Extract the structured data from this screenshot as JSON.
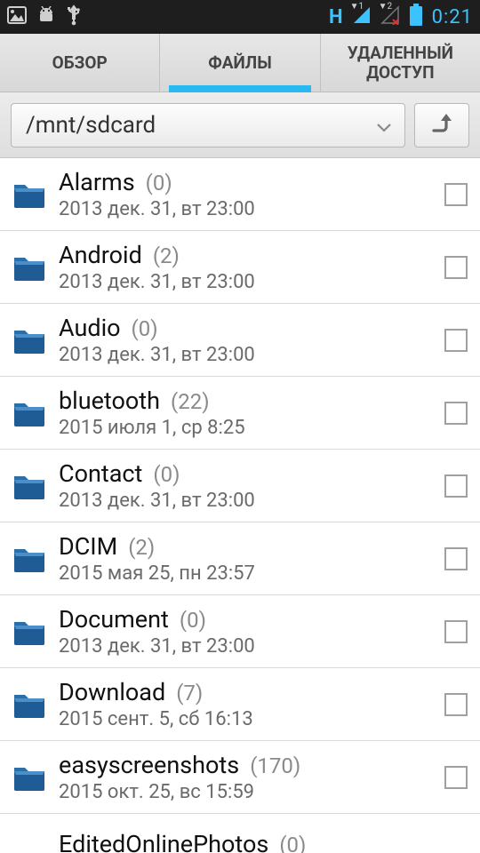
{
  "status": {
    "network_label": "H",
    "clock": "0:21",
    "sim1": "1",
    "sim2": "2"
  },
  "tabs": [
    {
      "label": "ОБЗОР",
      "active": false
    },
    {
      "label": "ФАЙЛЫ",
      "active": true
    },
    {
      "label": "УДАЛЕННЫЙ ДОСТУП",
      "active": false
    }
  ],
  "path": "/mnt/sdcard",
  "files": [
    {
      "name": "Alarms",
      "count": "(0)",
      "date": "2013 дек. 31, вт 23:00"
    },
    {
      "name": "Android",
      "count": "(2)",
      "date": "2013 дек. 31, вт 23:00"
    },
    {
      "name": "Audio",
      "count": "(0)",
      "date": "2013 дек. 31, вт 23:00"
    },
    {
      "name": "bluetooth",
      "count": "(22)",
      "date": "2015 июля 1, ср 8:25"
    },
    {
      "name": "Contact",
      "count": "(0)",
      "date": "2013 дек. 31, вт 23:00"
    },
    {
      "name": "DCIM",
      "count": "(2)",
      "date": "2015 мая 25, пн 23:57"
    },
    {
      "name": "Document",
      "count": "(0)",
      "date": "2013 дек. 31, вт 23:00"
    },
    {
      "name": "Download",
      "count": "(7)",
      "date": "2015 сент. 5, сб 16:13"
    },
    {
      "name": "easyscreenshots",
      "count": "(170)",
      "date": "2015 окт. 25, вс 15:59"
    },
    {
      "name": "EditedOnlinePhotos",
      "count": "(0)",
      "date": ""
    }
  ]
}
